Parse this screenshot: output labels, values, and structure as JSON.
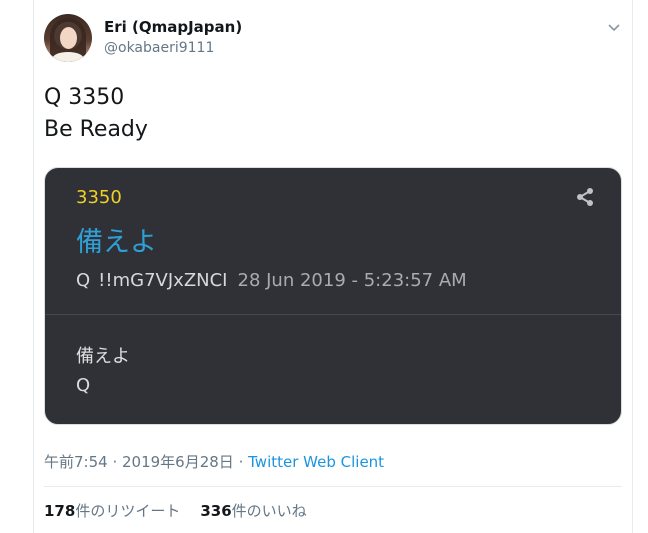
{
  "user": {
    "display_name": "Eri (QmapJapan)",
    "handle": "@okabaeri9111"
  },
  "tweet": {
    "line1": "Q 3350",
    "line2": "Be Ready"
  },
  "card": {
    "post_number": "3350",
    "title": "備えよ",
    "author": "Q",
    "tripcode": "!!mG7VJxZNCI",
    "date": "28 Jun 2019 - 5:23:57 AM",
    "body_line1": "備えよ",
    "body_line2": "Q"
  },
  "meta": {
    "time": "午前7:54",
    "separator": " · ",
    "date": "2019年6月28日",
    "separator2": " · ",
    "client": "Twitter Web Client"
  },
  "stats": {
    "retweet_count": "178",
    "retweet_label": "件のリツイート",
    "like_count": "336",
    "like_label": "件のいいね"
  },
  "colors": {
    "card_bg": "#2f3136",
    "card_number": "#f0d126",
    "card_title": "#2f9fd6",
    "link": "#1b95e0"
  },
  "icons": [
    "chevron-down-icon",
    "share-icon"
  ]
}
